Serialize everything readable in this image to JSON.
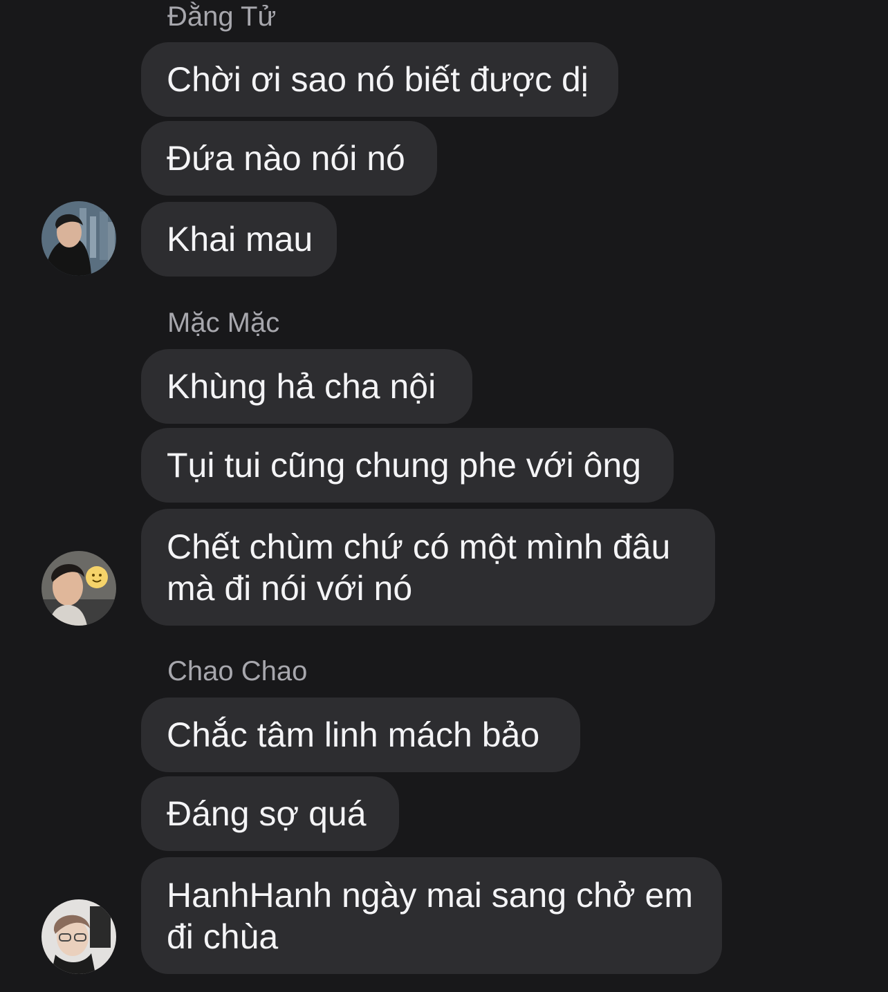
{
  "thread": {
    "groups": [
      {
        "sender": "Đằng Tử",
        "avatar_icon": "user-avatar-icon",
        "messages": [
          "Chời ơi sao nó biết được dị",
          "Đứa nào nói nó",
          "Khai mau"
        ]
      },
      {
        "sender": "Mặc Mặc",
        "avatar_icon": "user-avatar-icon",
        "messages": [
          "Khùng hả cha nội",
          "Tụi tui cũng chung phe với ông",
          "Chết chùm chứ có một mình đâu mà đi nói với nó"
        ]
      },
      {
        "sender": "Chao Chao",
        "avatar_icon": "user-avatar-icon",
        "messages": [
          "Chắc tâm linh mách bảo",
          "Đáng sợ quá",
          "HanhHanh ngày mai sang chở em đi chùa"
        ]
      }
    ]
  },
  "colors": {
    "background": "#18181a",
    "bubble": "#2d2d30",
    "sender_name": "#a7a7ad",
    "message_text": "#f4f4f6"
  }
}
